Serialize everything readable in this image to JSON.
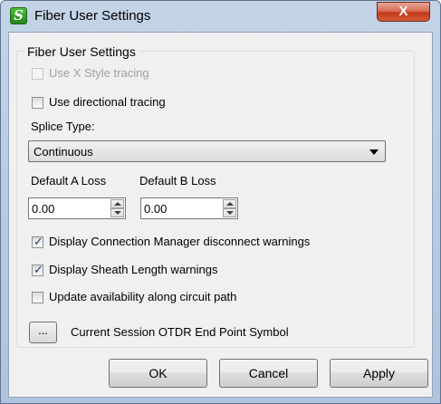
{
  "window": {
    "title": "Fiber User Settings",
    "close_label": "X"
  },
  "group": {
    "title": "Fiber User Settings",
    "use_x_style": {
      "label": "Use X Style tracing",
      "checked": false,
      "enabled": false
    },
    "use_directional": {
      "label": "Use directional tracing",
      "checked": false
    },
    "splice_type": {
      "label": "Splice Type:",
      "value": "Continuous"
    },
    "default_a_loss": {
      "label": "Default A Loss",
      "value": "0.00"
    },
    "default_b_loss": {
      "label": "Default B Loss",
      "value": "0.00"
    },
    "display_conn_mgr": {
      "label": "Display Connection Manager disconnect warnings",
      "checked": true
    },
    "display_sheath": {
      "label": "Display Sheath Length warnings",
      "checked": true
    },
    "update_availability": {
      "label": "Update availability along circuit path",
      "checked": false
    },
    "otdr": {
      "button_label": "...",
      "label": "Current Session OTDR End Point Symbol"
    }
  },
  "buttons": {
    "ok": "OK",
    "cancel": "Cancel",
    "apply": "Apply"
  },
  "colors": {
    "title_bar": "#b9cde3",
    "close_button": "#c23a1f",
    "check": "#1c3a74",
    "app_icon": "#21861a"
  },
  "icons": {
    "app": "app-logo-icon",
    "close": "close-icon",
    "check": "checkmark-icon",
    "dropdown": "chevron-down-icon"
  }
}
